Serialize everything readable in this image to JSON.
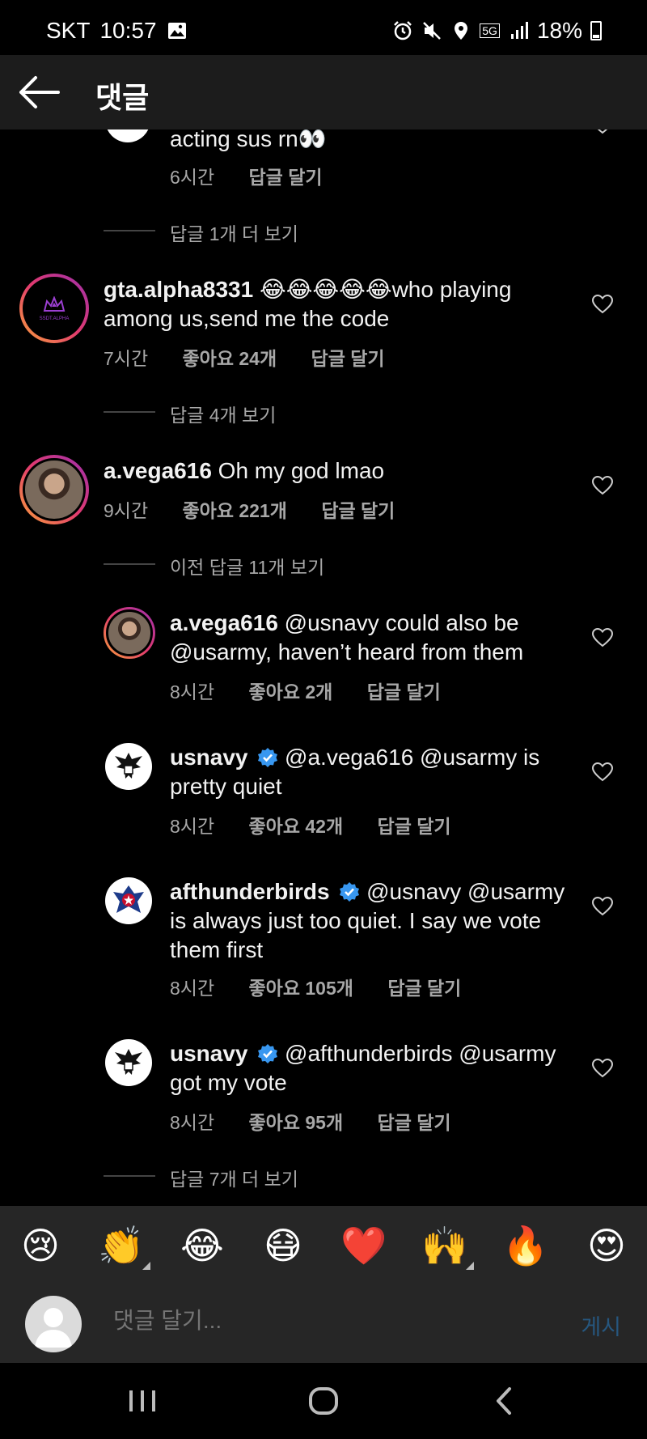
{
  "status_bar": {
    "carrier": "SKT",
    "time": "10:57",
    "network": "5G",
    "battery": "18%"
  },
  "header": {
    "title": "댓글"
  },
  "comments": {
    "top_partial": {
      "text": "acting sus rn👀",
      "time": "6시간",
      "reply": "답글 달기"
    },
    "more_replies_1": "답글 1개 더 보기",
    "c1": {
      "username": "gta.alpha8331",
      "text_line1": " 😂😂😂😂😂who playing",
      "text_line2": "among us,send me the code",
      "time": "7시간",
      "likes": "좋아요 24개",
      "reply": "답글 달기",
      "avatar_text": "SSDT.ALPHA"
    },
    "view_replies_2": "답글 4개 보기",
    "c2": {
      "username": "a.vega616",
      "text": " Oh my god lmao",
      "time": "9시간",
      "likes": "좋아요 221개",
      "reply": "답글 달기"
    },
    "previous_replies": "이전 답글 11개 보기",
    "r1": {
      "username": "a.vega616",
      "text_line1": " @usnavy could also be",
      "text_line2": "@usarmy, haven’t heard from them",
      "time": "8시간",
      "likes": "좋아요 2개",
      "reply": "답글 달기"
    },
    "r2": {
      "username": "usnavy",
      "text_line1": " @a.vega616 @usarmy is",
      "text_line2": "pretty quiet",
      "time": "8시간",
      "likes": "좋아요 42개",
      "reply": "답글 달기"
    },
    "r3": {
      "username": "afthunderbirds",
      "text_line1": " @usnavy @usarmy",
      "text_line2": "is always just too quiet. I say we vote",
      "text_line3": "them first",
      "time": "8시간",
      "likes": "좋아요 105개",
      "reply": "답글 달기"
    },
    "r4": {
      "username": "usnavy",
      "text_line1": " @afthunderbirds @usarmy",
      "text_line2": "got my vote",
      "time": "8시간",
      "likes": "좋아요 95개",
      "reply": "답글 달기"
    },
    "more_replies_2": "답글 7개 더 보기"
  },
  "emoji_bar": [
    "😢",
    "👏",
    "😂",
    "😷",
    "❤️",
    "🙌",
    "🔥",
    "😍"
  ],
  "input": {
    "placeholder": "댓글 달기...",
    "post": "게시"
  },
  "colors": {
    "background": "#000000",
    "header": "#1c1c1c",
    "verified": "#3897f0",
    "post_disabled": "#26577f"
  }
}
